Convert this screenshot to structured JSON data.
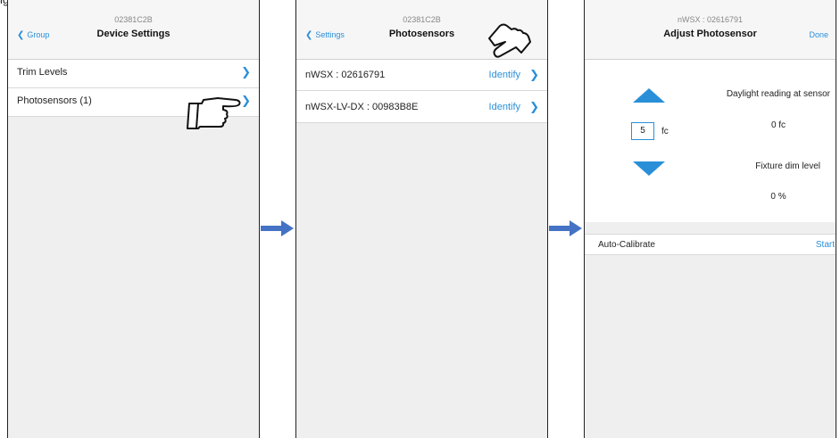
{
  "caption": "ightingtheightinggsthephotosensorstheoppinngs",
  "screen1": {
    "device_id": "02381C2B",
    "title": "Device Settings",
    "back_label": "Group",
    "rows": [
      {
        "label": "Trim Levels"
      },
      {
        "label": "Photosensors (1)"
      }
    ]
  },
  "screen2": {
    "device_id": "02381C2B",
    "title": "Photosensors",
    "back_label": "Settings",
    "rows": [
      {
        "label": "nWSX : 02616791",
        "action": "Identify"
      },
      {
        "label": "nWSX-LV-DX : 00983B8E",
        "action": "Identify"
      }
    ]
  },
  "screen3": {
    "device_id": "nWSX : 02616791",
    "title": "Adjust Photosensor",
    "done_label": "Done",
    "setpoint_value": "5",
    "setpoint_unit": "fc",
    "daylight_label": "Daylight reading at sensor",
    "daylight_value": "0 fc",
    "dim_label": "Fixture dim level",
    "dim_value": "0 %",
    "auto_calibrate_label": "Auto-Calibrate",
    "start_label": "Start"
  },
  "colors": {
    "accent": "#2a8fd8",
    "arrow": "#4472c4",
    "background": "#efefef"
  },
  "icons": [
    "chevron-left-icon",
    "chevron-right-icon",
    "pointing-hand-icon",
    "flow-arrow-icon",
    "increase-triangle-icon",
    "decrease-triangle-icon"
  ]
}
